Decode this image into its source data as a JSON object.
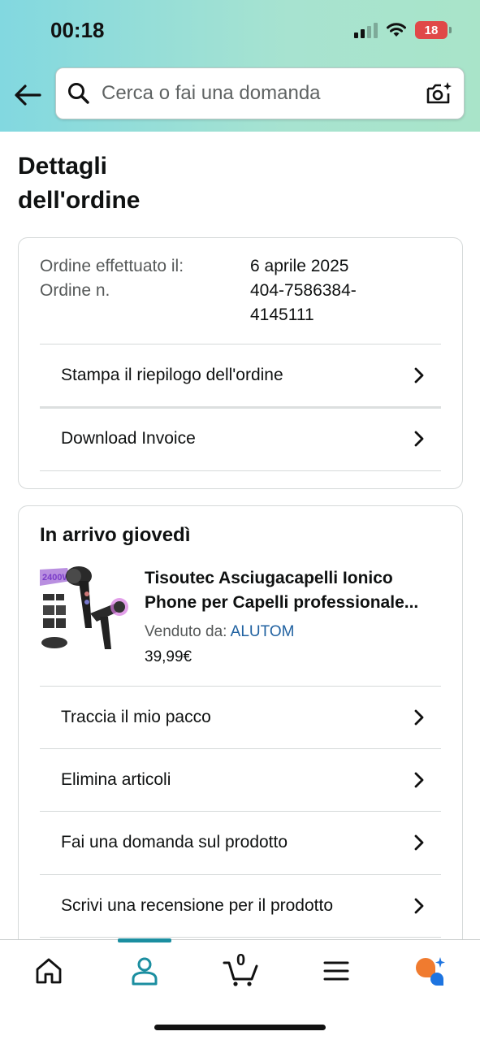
{
  "status_bar": {
    "time": "00:18",
    "battery": "18"
  },
  "search": {
    "placeholder": "Cerca o fai una domanda"
  },
  "page": {
    "title_line1": "Dettagli",
    "title_line2": "dell'ordine"
  },
  "order_info": {
    "placed_label": "Ordine effettuato il:",
    "placed_value": "6 aprile 2025",
    "number_label": "Ordine n.",
    "number_value_line1": "404-7586384-",
    "number_value_line2": "4145111",
    "actions": [
      {
        "label": "Stampa il riepilogo dell'ordine"
      },
      {
        "label": "Download Invoice"
      }
    ]
  },
  "shipment": {
    "title": "In arrivo giovedì",
    "product": {
      "name_line1": "Tisoutec Asciugacapelli Ionico",
      "name_line2": "Phone per Capelli professionale...",
      "sold_by_label": "Venduto da:",
      "seller": "ALUTOM",
      "price": "39,99€",
      "image_badge": "2400W"
    },
    "actions": [
      {
        "label": "Traccia il mio pacco"
      },
      {
        "label": "Elimina articoli"
      },
      {
        "label": "Fai una domanda sul prodotto"
      },
      {
        "label": "Scrivi una recensione per il prodotto"
      }
    ]
  },
  "bottom_nav": {
    "items": [
      {
        "icon": "home-icon"
      },
      {
        "icon": "account-icon",
        "active": true
      },
      {
        "icon": "cart-icon",
        "count": "0"
      },
      {
        "icon": "menu-icon"
      },
      {
        "icon": "rufus-assistant-icon"
      }
    ]
  },
  "colors": {
    "header_gradient_start": "#82d8e0",
    "header_gradient_end": "#a9e4c9",
    "link": "#2162a1",
    "active_nav": "#1b8ea0",
    "battery_low": "#e04848"
  }
}
